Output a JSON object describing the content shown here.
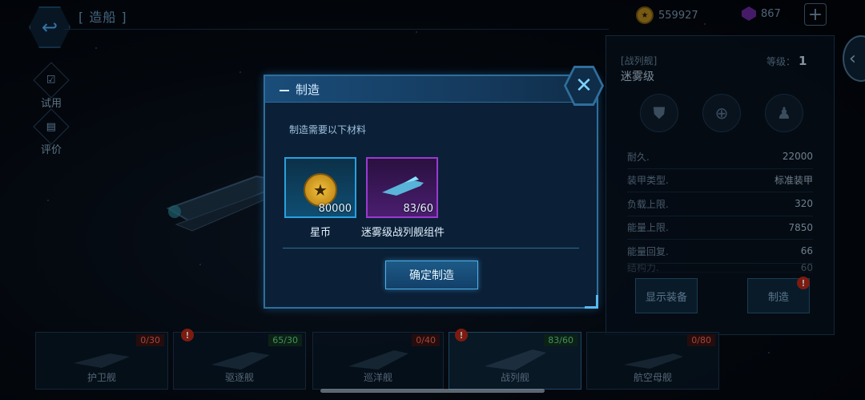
{
  "topbar": {
    "title": "[ 造船 ]",
    "coins": "559927",
    "gems": "867",
    "plus": "+"
  },
  "side": {
    "trial_label": "试用",
    "review_label": "评价"
  },
  "ship_info": {
    "class_label": "[战列舰]",
    "name": "迷雾级",
    "level_label": "等级：",
    "level_value": "1",
    "stats": [
      {
        "key": "耐久.",
        "value": "22000"
      },
      {
        "key": "装甲类型.",
        "value": "标准装甲"
      },
      {
        "key": "负载上限.",
        "value": "320"
      },
      {
        "key": "能量上限.",
        "value": "7850"
      },
      {
        "key": "能量回复.",
        "value": "66"
      },
      {
        "key": "结构力.",
        "value": "60"
      }
    ],
    "show_equipment_label": "显示装备",
    "build_label": "制造"
  },
  "tabs": [
    {
      "label": "护卫舰",
      "count": "0/30",
      "count_color": "red",
      "alert": false
    },
    {
      "label": "驱逐舰",
      "count": "65/30",
      "count_color": "green",
      "alert": true
    },
    {
      "label": "巡洋舰",
      "count": "0/40",
      "count_color": "red",
      "alert": false
    },
    {
      "label": "战列舰",
      "count": "83/60",
      "count_color": "green",
      "alert": true
    },
    {
      "label": "航空母舰",
      "count": "0/80",
      "count_color": "red",
      "alert": false
    }
  ],
  "modal": {
    "title": "制造",
    "subtitle": "制造需要以下材料",
    "materials": [
      {
        "name": "星币",
        "qty": "80000",
        "rarity": "blue",
        "icon": "star-coin-icon"
      },
      {
        "name": "迷雾级战列舰组件",
        "qty": "83/60",
        "rarity": "purple",
        "icon": "ship-part-icon"
      }
    ],
    "confirm_label": "确定制造",
    "close_label": "✕"
  },
  "colors": {
    "accent": "#2f6e9c",
    "confirm": "#1d5a86",
    "purple_rarity": "#9a3ad0",
    "blue_rarity": "#2aa0e0"
  }
}
